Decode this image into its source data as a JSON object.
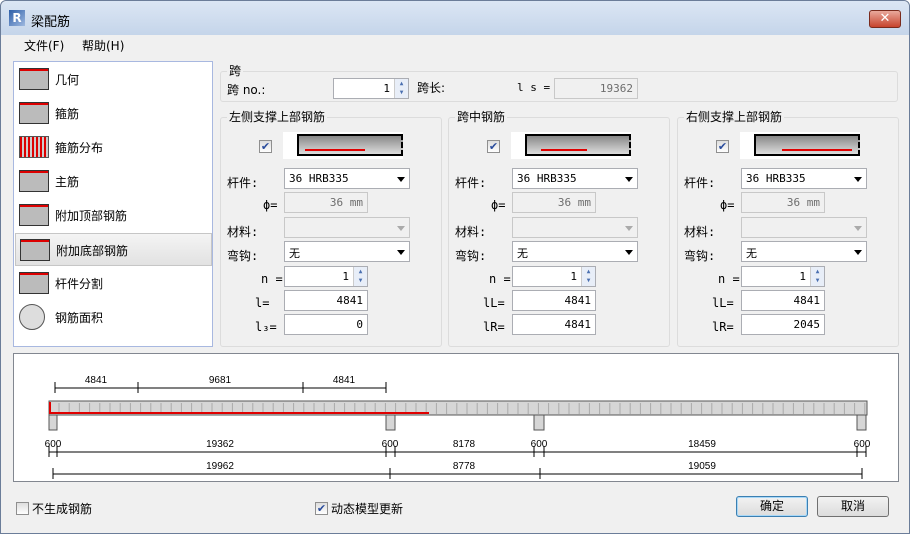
{
  "window": {
    "title": "梁配筋",
    "close": "✕"
  },
  "menu": [
    {
      "label": "文件(F)"
    },
    {
      "label": "帮助(H)"
    }
  ],
  "sidebar": {
    "selected": "附加底部钢筋",
    "items": [
      {
        "label": "几何",
        "icon": "beam-geometry-icon"
      },
      {
        "label": "箍筋",
        "icon": "stirrup-icon"
      },
      {
        "label": "箍筋分布",
        "icon": "stirrup-distribution-icon"
      },
      {
        "label": "主筋",
        "icon": "main-rebar-icon"
      },
      {
        "label": "附加顶部钢筋",
        "icon": "additional-top-rebar-icon"
      },
      {
        "label": "附加底部钢筋",
        "icon": "additional-bottom-rebar-icon"
      },
      {
        "label": "杆件分割",
        "icon": "bar-split-icon"
      },
      {
        "label": "钢筋面积",
        "icon": "rebar-area-icon"
      }
    ]
  },
  "span": {
    "group": "跨",
    "no_label": "跨 no.:",
    "no_value": "1",
    "length_label": "跨长:",
    "ls_label": "l s =",
    "ls_value": "19362"
  },
  "panels": [
    {
      "title": "左侧支撑上部钢筋",
      "checked": true,
      "bar_label": "杆件:",
      "bar": "36 HRB335",
      "phi_label": "ϕ=",
      "phi": "36 mm",
      "mat_label": "材料:",
      "mat": "",
      "hook_label": "弯钩:",
      "hook": "无",
      "n_label": "n =",
      "n": "1",
      "l1_label": "l=",
      "l1": "4841",
      "l2_label": "l₃=",
      "l2": "0"
    },
    {
      "title": "跨中钢筋",
      "checked": true,
      "bar_label": "杆件:",
      "bar": "36 HRB335",
      "phi_label": "ϕ=",
      "phi": "36 mm",
      "mat_label": "材料:",
      "mat": "",
      "hook_label": "弯钩:",
      "hook": "无",
      "n_label": "n =",
      "n": "1",
      "l1_label": "lL=",
      "l1": "4841",
      "l2_label": "lR=",
      "l2": "4841"
    },
    {
      "title": "右侧支撑上部钢筋",
      "checked": true,
      "bar_label": "杆件:",
      "bar": "36 HRB335",
      "phi_label": "ϕ=",
      "phi": "36 mm",
      "mat_label": "材料:",
      "mat": "",
      "hook_label": "弯钩:",
      "hook": "无",
      "n_label": "n =",
      "n": "1",
      "l1_label": "lL=",
      "l1": "4841",
      "l2_label": "lR=",
      "l2": "2045"
    }
  ],
  "drawing": {
    "top_dims": [
      "4841",
      "9681",
      "4841"
    ],
    "row1": [
      "600",
      "19362",
      "600",
      "8178",
      "600",
      "18459",
      "600"
    ],
    "row2": [
      "19962",
      "8778",
      "19059"
    ],
    "rebar_color": "#e00000"
  },
  "footer": {
    "no_rebar_label": "不生成钢筋",
    "no_rebar_checked": false,
    "dynamic_label": "动态模型更新",
    "dynamic_checked": true,
    "ok": "确定",
    "cancel": "取消"
  }
}
